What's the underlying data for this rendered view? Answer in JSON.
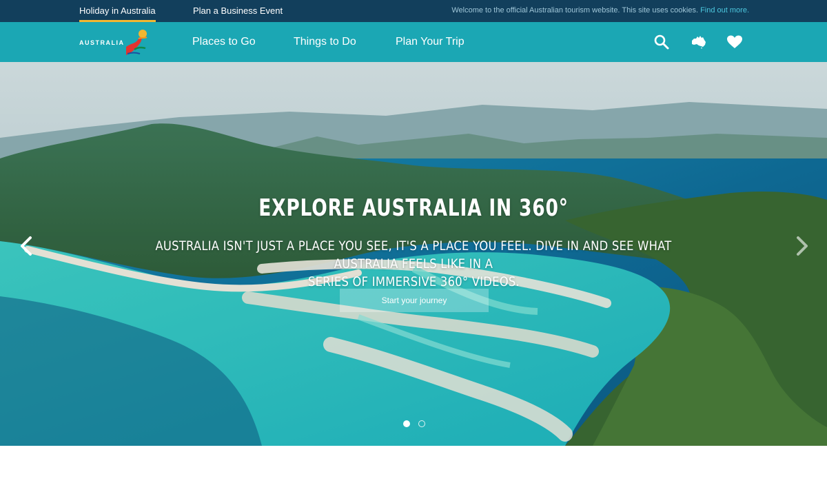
{
  "topbar": {
    "tabs": [
      {
        "label": "Holiday in Australia",
        "active": true
      },
      {
        "label": "Plan a Business Event",
        "active": false
      }
    ],
    "cookie_text": "Welcome to the official Australian tourism website. This site uses cookies.",
    "cookie_link": "Find out more."
  },
  "nav": {
    "logo_text": "AUSTRALIA",
    "links": [
      "Places to Go",
      "Things to Do",
      "Plan Your Trip"
    ],
    "icons": [
      "search-icon",
      "australia-map-icon",
      "heart-icon"
    ]
  },
  "hero": {
    "title": "EXPLORE AUSTRALIA IN 360°",
    "subtitle_line1": "AUSTRALIA ISN'T JUST A PLACE YOU SEE, IT'S A PLACE YOU FEEL. DIVE IN AND SEE WHAT AUSTRALIA FEELS LIKE IN A",
    "subtitle_line2": "SERIES OF IMMERSIVE 360° VIDEOS.",
    "cta_label": "Start your journey",
    "slide_count": 2,
    "active_slide": 1
  },
  "colors": {
    "topbar": "#123f5c",
    "nav": "#1ba7b4",
    "active_underline": "#f2b731",
    "cookie_link": "#4cc7de"
  }
}
